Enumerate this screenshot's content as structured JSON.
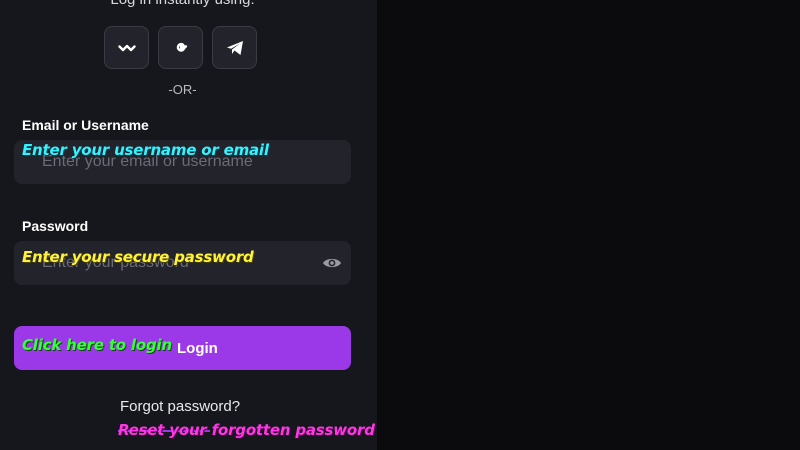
{
  "header": {
    "login_instantly_text": "Log in instantly using:"
  },
  "social": {
    "buttons": [
      {
        "icon": "walletconnect-icon",
        "label": "WalletConnect"
      },
      {
        "icon": "google-icon",
        "label": "Google"
      },
      {
        "icon": "telegram-icon",
        "label": "Telegram"
      }
    ],
    "or_divider": "-OR-"
  },
  "email_field": {
    "label": "Email or Username",
    "placeholder": "Enter your email or username",
    "annotation": "Enter your username or email"
  },
  "password_field": {
    "label": "Password",
    "placeholder": "Enter your password",
    "annotation": "Enter your secure password",
    "toggle_icon": "eye-icon"
  },
  "login_button": {
    "label": "Login",
    "annotation": "Click here to login"
  },
  "forgot_password": {
    "label": "Forgot password?",
    "annotation": "Reset your forgotten password"
  },
  "colors": {
    "panel_bg": "#16161d",
    "input_bg": "#23232c",
    "accent": "#9b39e8",
    "annotation_cyan": "#34f3ff",
    "annotation_yellow": "#fff23a",
    "annotation_green": "#36ff3c",
    "annotation_pink": "#ff36e6"
  }
}
